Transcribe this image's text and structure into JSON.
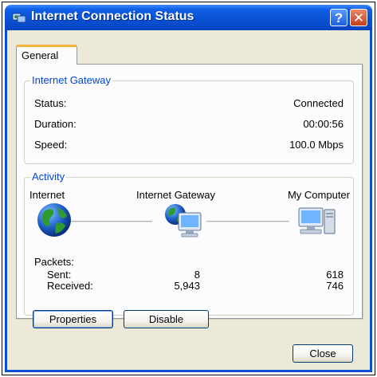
{
  "window": {
    "title": "Internet Connection Status",
    "help_glyph": "?",
    "close_glyph": "✕"
  },
  "tabs": [
    {
      "label": "General",
      "selected": true
    }
  ],
  "gateway_group": {
    "title": "Internet Gateway",
    "rows": [
      {
        "label": "Status:",
        "value": "Connected"
      },
      {
        "label": "Duration:",
        "value": "00:00:56"
      },
      {
        "label": "Speed:",
        "value": "100.0 Mbps"
      }
    ]
  },
  "activity_group": {
    "title": "Activity",
    "nodes": [
      "Internet",
      "Internet Gateway",
      "My Computer"
    ],
    "icons": [
      "globe-icon",
      "gateway-computer-icon",
      "my-computer-icon"
    ],
    "packets": {
      "title": "Packets:",
      "sent_label": "Sent:",
      "received_label": "Received:",
      "gateway_sent": "8",
      "gateway_received": "5,943",
      "computer_sent": "618",
      "computer_received": "746"
    }
  },
  "buttons": {
    "properties": "Properties",
    "disable": "Disable",
    "close": "Close"
  },
  "colors": {
    "titlebar": "#0a52d6",
    "group_title": "#0046d5",
    "tab_accent": "#f3b13e",
    "client_bg": "#ece9d8"
  }
}
